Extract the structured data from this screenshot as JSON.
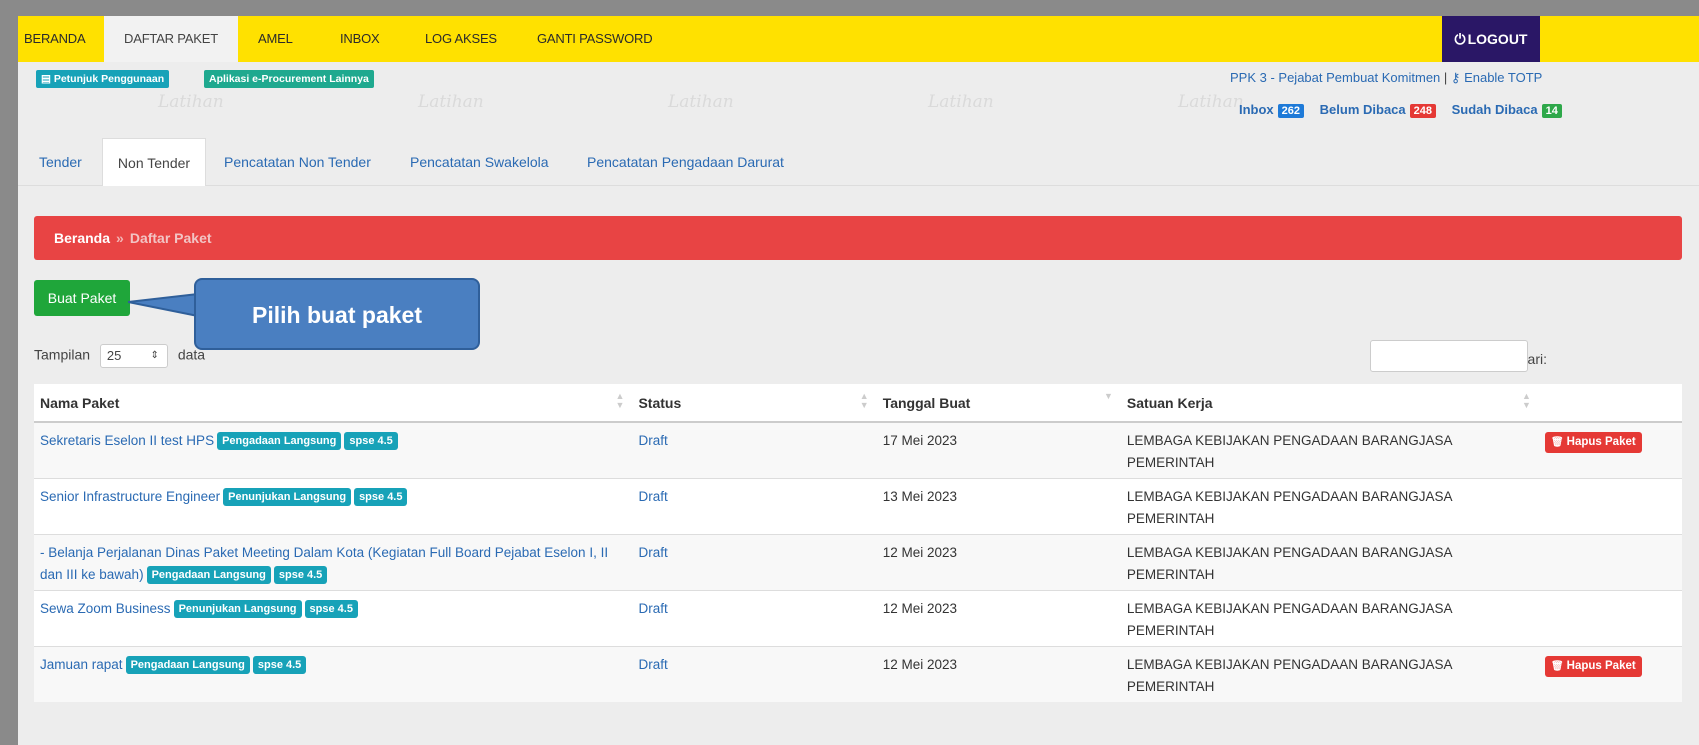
{
  "nav": {
    "items": [
      "BERANDA",
      "DAFTAR PAKET",
      "AMEL",
      "INBOX",
      "LOG AKSES",
      "GANTI PASSWORD"
    ],
    "logout": "LOGOUT"
  },
  "sub": {
    "petunjuk": "Petunjuk Penggunaan",
    "aplikasi": "Aplikasi e-Procurement Lainnya",
    "watermark": "Latihan",
    "role": "PPK 3 - Pejabat Pembuat Komitmen",
    "totp": "Enable TOTP",
    "inbox_label": "Inbox",
    "inbox_count": "262",
    "unread_label": "Belum Dibaca",
    "unread_count": "248",
    "read_label": "Sudah Dibaca",
    "read_count": "14"
  },
  "tabs": [
    "Tender",
    "Non Tender",
    "Pencatatan Non Tender",
    "Pencatatan Swakelola",
    "Pencatatan Pengadaan Darurat"
  ],
  "breadcrumb": {
    "home": "Beranda",
    "sep": "»",
    "current": "Daftar Paket"
  },
  "buat_paket": "Buat Paket",
  "callout": "Pilih buat paket",
  "length": {
    "prefix": "Tampilan",
    "value": "25",
    "suffix": "data"
  },
  "search_label": "Cari:",
  "table": {
    "headers": [
      "Nama Paket",
      "Status",
      "Tanggal Buat",
      "Satuan Kerja"
    ],
    "rows": [
      {
        "name": "Sekretaris Eselon II test HPS",
        "method": "Pengadaan Langsung",
        "version": "spse 4.5",
        "status": "Draft",
        "date": "17 Mei 2023",
        "unit": "LEMBAGA KEBIJAKAN PENGADAAN BARANGJASA PEMERINTAH",
        "action": "Hapus Paket"
      },
      {
        "name": "Senior Infrastructure Engineer",
        "method": "Penunjukan Langsung",
        "version": "spse 4.5",
        "status": "Draft",
        "date": "13 Mei 2023",
        "unit": "LEMBAGA KEBIJAKAN PENGADAAN BARANGJASA PEMERINTAH",
        "action": ""
      },
      {
        "name": "- Belanja Perjalanan Dinas Paket Meeting Dalam Kota (Kegiatan Full Board Pejabat Eselon I, II dan III ke bawah)",
        "method": "Pengadaan Langsung",
        "version": "spse 4.5",
        "status": "Draft",
        "date": "12 Mei 2023",
        "unit": "LEMBAGA KEBIJAKAN PENGADAAN BARANGJASA PEMERINTAH",
        "action": ""
      },
      {
        "name": "Sewa Zoom Business",
        "method": "Penunjukan Langsung",
        "version": "spse 4.5",
        "status": "Draft",
        "date": "12 Mei 2023",
        "unit": "LEMBAGA KEBIJAKAN PENGADAAN BARANGJASA PEMERINTAH",
        "action": ""
      },
      {
        "name": "Jamuan rapat",
        "method": "Pengadaan Langsung",
        "version": "spse 4.5",
        "status": "Draft",
        "date": "12 Mei 2023",
        "unit": "LEMBAGA KEBIJAKAN PENGADAAN BARANGJASA PEMERINTAH",
        "action": "Hapus Paket"
      }
    ]
  }
}
